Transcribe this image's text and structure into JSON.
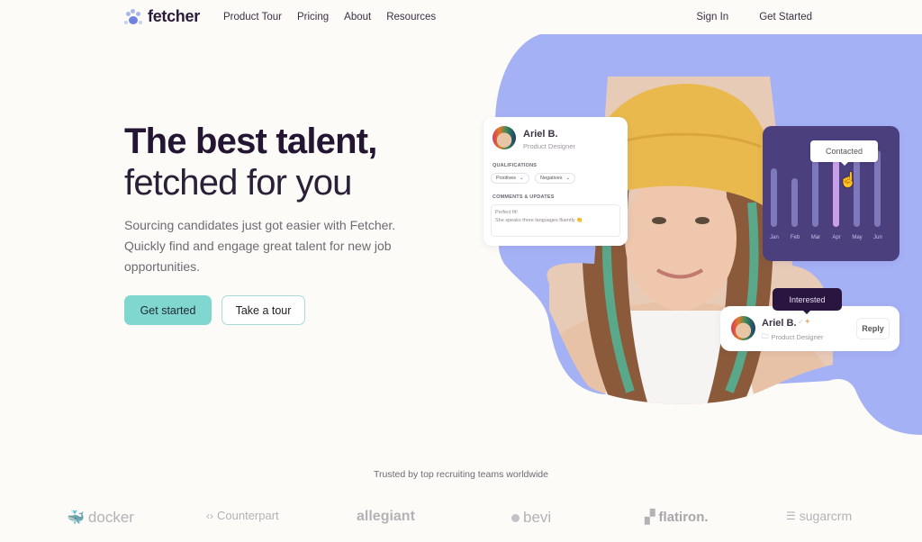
{
  "nav": {
    "logo_text": "fetcher",
    "links": [
      "Product Tour",
      "Pricing",
      "About",
      "Resources"
    ],
    "sign_in": "Sign In",
    "get_started": "Get Started"
  },
  "hero": {
    "title_bold": "The best talent,",
    "title_light": "fetched for you",
    "subtitle": "Sourcing candidates just got easier with Fetcher. Quickly find and engage great talent for new job opportunities.",
    "primary_cta": "Get started",
    "secondary_cta": "Take a tour"
  },
  "profile_card": {
    "name": "Ariel B.",
    "role": "Product Designer",
    "qualifications_label": "QUALIFICATIONS",
    "chips": [
      "Positives",
      "Negatives"
    ],
    "comments_label": "COMMENTS & UPDATES",
    "comment_line1": "Perfect fit!",
    "comment_line2": "She speaks three languages fluently 👏"
  },
  "chart_card": {
    "tooltip": "Contacted",
    "months": [
      "Jan",
      "Feb",
      "Mar",
      "Apr",
      "May",
      "Jun"
    ],
    "levels": [
      0.72,
      0.6,
      0.82,
      0.9,
      0.86,
      0.94
    ],
    "active_index": 3
  },
  "reply_card": {
    "tooltip": "Interested",
    "name": "Ariel B.",
    "role": "Product Designer",
    "reply_label": "Reply"
  },
  "trusted": {
    "heading": "Trusted by top recruiting teams worldwide",
    "brands": [
      "docker",
      "Counterpart",
      "allegiant",
      "bevi",
      "flatiron.",
      "sugarcrm"
    ]
  },
  "colors": {
    "accent_teal": "#7fd7d0",
    "blob_purple": "#a5b1f5",
    "chart_bg": "#4b3f7e",
    "chart_active": "#c9a0e8",
    "dark_tooltip": "#2a1540"
  }
}
